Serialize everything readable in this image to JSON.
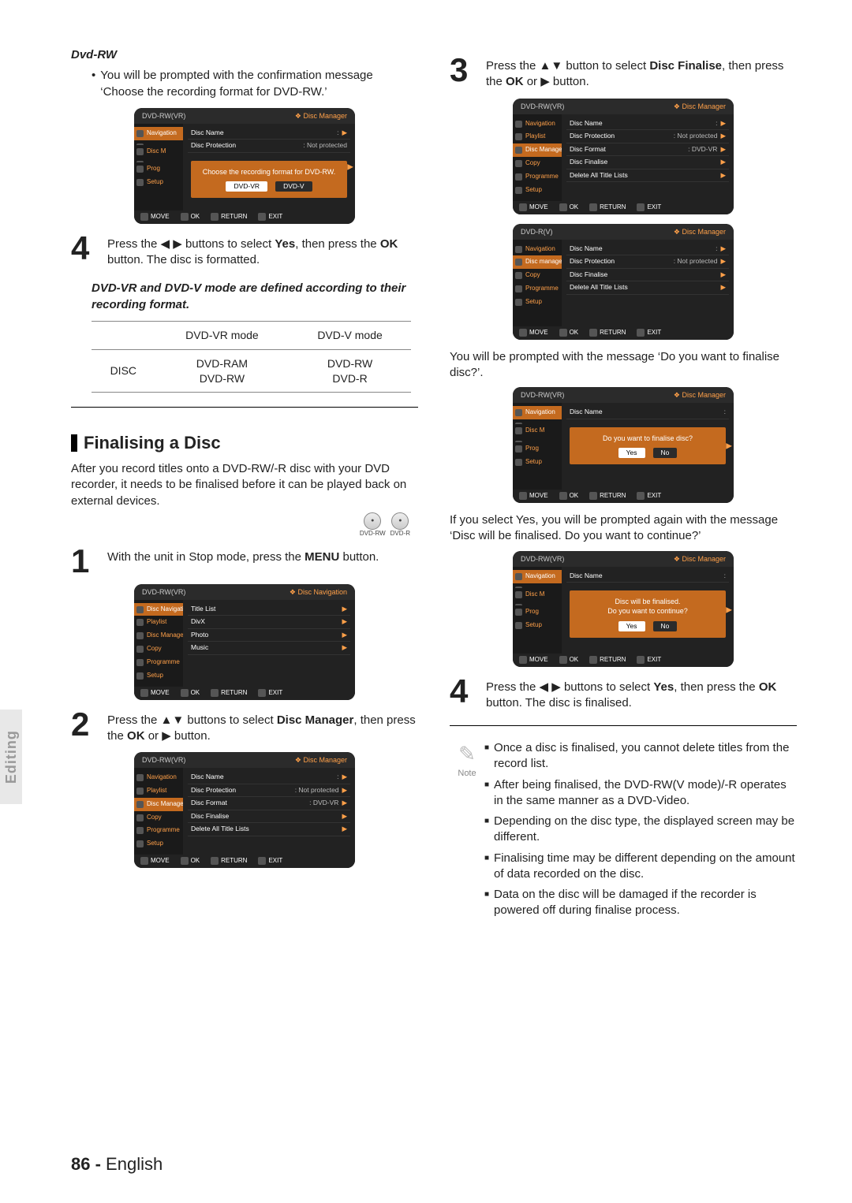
{
  "section_side": "Editing",
  "left": {
    "dvdrw_heading": "Dvd-RW",
    "dvdrw_bullet": "You will be prompted with the confirmation message ‘Choose the recording format for DVD-RW.’",
    "osd_format": {
      "header_left": "DVD-RW(VR)",
      "header_right": "❖ Disc Manager",
      "side_items": [
        "Navigation",
        "",
        "Disc M",
        "",
        "Prog",
        "Setup"
      ],
      "rows": [
        {
          "k": "Disc Name",
          "v": ":",
          "arrow": "▶"
        },
        {
          "k": "Disc Protection",
          "v": ": Not protected",
          "arrow": ""
        }
      ],
      "dialog_text": "Choose the recording format for DVD-RW.",
      "dialog_btns": [
        "DVD-VR",
        "DVD-V"
      ],
      "footer": [
        "MOVE",
        "OK",
        "RETURN",
        "EXIT"
      ]
    },
    "step4_a": "Press the ",
    "step4_b": " buttons to select ",
    "step4_yes": "Yes",
    "step4_c": ", then press the ",
    "step4_ok": "OK",
    "step4_d": " button. The disc is formatted.",
    "mode_note": "DVD-VR and DVD-V mode are defined according to their recording format.",
    "table": {
      "h1": "DVD-VR mode",
      "h2": "DVD-V mode",
      "rlabel": "DISC",
      "c1a": "DVD-RAM",
      "c1b": "DVD-RW",
      "c2a": "DVD-RW",
      "c2b": "DVD-R"
    },
    "finalising_heading": "Finalising a Disc",
    "finalising_intro": "After you record titles onto a DVD-RW/-R disc with your DVD recorder, it needs to be finalised before it can be played back on external devices.",
    "badges": [
      "DVD-RW",
      "DVD-R"
    ],
    "step1_a": "With the unit in Stop mode, press the ",
    "step1_menu": "MENU",
    "step1_b": " button.",
    "osd_nav": {
      "header_left": "DVD-RW(VR)",
      "header_right": "❖ Disc Navigation",
      "side_items": [
        "Disc Navigation",
        "Playlist",
        "Disc Manager",
        "Copy",
        "Programme",
        "Setup"
      ],
      "rows": [
        {
          "k": "Title List",
          "arrow": "▶"
        },
        {
          "k": "DivX",
          "arrow": "▶"
        },
        {
          "k": "Photo",
          "arrow": "▶"
        },
        {
          "k": "Music",
          "arrow": "▶"
        }
      ],
      "footer": [
        "MOVE",
        "OK",
        "RETURN",
        "EXIT"
      ]
    },
    "step2_a": "Press the ",
    "step2_b": " buttons to select ",
    "step2_dm": "Disc Manager",
    "step2_c": ", then press the ",
    "step2_ok": "OK",
    "step2_d": " or ▶ button.",
    "osd_dm": {
      "header_left": "DVD-RW(VR)",
      "header_right": "❖ Disc Manager",
      "side_items": [
        "Navigation",
        "Playlist",
        "Disc Manager",
        "Copy",
        "Programme",
        "Setup"
      ],
      "rows": [
        {
          "k": "Disc Name",
          "v": ":",
          "arrow": "▶"
        },
        {
          "k": "Disc Protection",
          "v": ": Not protected",
          "arrow": "▶"
        },
        {
          "k": "Disc Format",
          "v": ": DVD-VR",
          "arrow": "▶"
        },
        {
          "k": "Disc Finalise",
          "v": "",
          "arrow": "▶"
        },
        {
          "k": "Delete All Title Lists",
          "v": "",
          "arrow": "▶"
        }
      ],
      "footer": [
        "MOVE",
        "OK",
        "RETURN",
        "EXIT"
      ]
    }
  },
  "right": {
    "step3_a": "Press the ",
    "step3_b": " button to select ",
    "step3_df": "Disc Finalise",
    "step3_c": ", then press the ",
    "step3_ok": "OK",
    "step3_d": " or ▶ button.",
    "osd_rwvr": {
      "header_left": "DVD-RW(VR)",
      "header_right": "❖ Disc Manager",
      "side_items": [
        "Navigation",
        "Playlist",
        "Disc Manager",
        "Copy",
        "Programme",
        "Setup"
      ],
      "rows": [
        {
          "k": "Disc Name",
          "v": ":",
          "arrow": "▶"
        },
        {
          "k": "Disc Protection",
          "v": ": Not protected",
          "arrow": "▶"
        },
        {
          "k": "Disc Format",
          "v": ": DVD-VR",
          "arrow": "▶"
        },
        {
          "k": "Disc Finalise",
          "v": "",
          "arrow": "▶"
        },
        {
          "k": "Delete All Title Lists",
          "v": "",
          "arrow": "▶"
        }
      ],
      "footer": [
        "MOVE",
        "OK",
        "RETURN",
        "EXIT"
      ]
    },
    "osd_rv": {
      "header_left": "DVD-R(V)",
      "header_right": "❖ Disc Manager",
      "side_items": [
        "Navigation",
        "Disc manager",
        "Copy",
        "Programme",
        "Setup"
      ],
      "rows": [
        {
          "k": "Disc Name",
          "v": ":",
          "arrow": "▶"
        },
        {
          "k": "Disc Protection",
          "v": ": Not protected",
          "arrow": "▶"
        },
        {
          "k": "Disc Finalise",
          "v": "",
          "arrow": "▶"
        },
        {
          "k": "Delete All Title Lists",
          "v": "",
          "arrow": "▶"
        }
      ],
      "footer": [
        "MOVE",
        "OK",
        "RETURN",
        "EXIT"
      ]
    },
    "prompt1": "You will be prompted with the message ‘Do you want to finalise disc?’.",
    "osd_finalise": {
      "header_left": "DVD-RW(VR)",
      "header_right": "❖ Disc Manager",
      "side_items": [
        "Navigation",
        "",
        "Disc M",
        "",
        "Prog",
        "Setup"
      ],
      "rows": [
        {
          "k": "Disc Name",
          "v": ":",
          "arrow": ""
        }
      ],
      "dialog_text": "Do you want to finalise disc?",
      "dialog_btns": [
        "Yes",
        "No"
      ],
      "footer": [
        "MOVE",
        "OK",
        "RETURN",
        "EXIT"
      ]
    },
    "prompt2": "If you select Yes, you will be prompted again with the message ‘Disc will be finalised. Do you want to continue?’",
    "osd_continue": {
      "header_left": "DVD-RW(VR)",
      "header_right": "❖ Disc Manager",
      "side_items": [
        "Navigation",
        "",
        "Disc M",
        "",
        "Prog",
        "Setup"
      ],
      "rows": [
        {
          "k": "Disc Name",
          "v": ":",
          "arrow": ""
        }
      ],
      "dialog_text": "Disc will be finalised.\nDo you want to continue?",
      "dialog_btns": [
        "Yes",
        "No"
      ],
      "footer": [
        "MOVE",
        "OK",
        "RETURN",
        "EXIT"
      ]
    },
    "step4_a": "Press the ",
    "step4_b": " buttons to select ",
    "step4_yes": "Yes",
    "step4_c": ", then press the ",
    "step4_ok": "OK",
    "step4_d": " button. The disc is finalised.",
    "note_label": "Note",
    "notes": [
      "Once a disc is finalised, you cannot delete titles from the record list.",
      "After being finalised, the DVD-RW(V mode)/-R operates in the same manner as a DVD-Video.",
      "Depending on the disc type, the displayed screen may be different.",
      "Finalising time may be different depending on the amount of data recorded on the disc.",
      "Data on the disc will be damaged if the recorder is powered off during finalise process."
    ]
  },
  "glyph": {
    "lr": "◀ ▶",
    "ud": "▲▼",
    "note": "✎"
  },
  "pagenum": "86 -",
  "pagelang": "English"
}
